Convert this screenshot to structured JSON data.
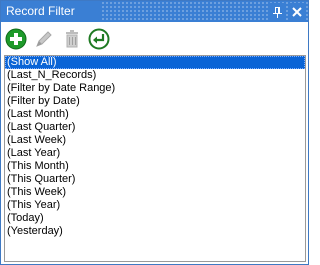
{
  "window": {
    "title": "Record Filter",
    "pin_glyph": "Ɫ",
    "close_glyph": "✕"
  },
  "toolbar": {
    "buttons": [
      {
        "name": "add",
        "icon": "add-circle-icon",
        "enabled": true
      },
      {
        "name": "edit",
        "icon": "pencil-icon",
        "enabled": false
      },
      {
        "name": "delete",
        "icon": "trash-icon",
        "enabled": false
      },
      {
        "name": "apply",
        "icon": "return-arrow-icon",
        "enabled": true
      }
    ]
  },
  "filters": {
    "selected_index": 0,
    "items": [
      "(Show All)",
      "(Last_N_Records)",
      "(Filter by Date Range)",
      "(Filter by Date)",
      "(Last Month)",
      "(Last Quarter)",
      "(Last Week)",
      "(Last Year)",
      "(This Month)",
      "(This Quarter)",
      "(This Week)",
      "(This Year)",
      "(Today)",
      "(Yesterday)"
    ]
  },
  "colors": {
    "title_bar": "#3a7fd4",
    "selection": "#0a64d6",
    "add_green": "#1e9a2a",
    "apply_green": "#1e7a22"
  }
}
